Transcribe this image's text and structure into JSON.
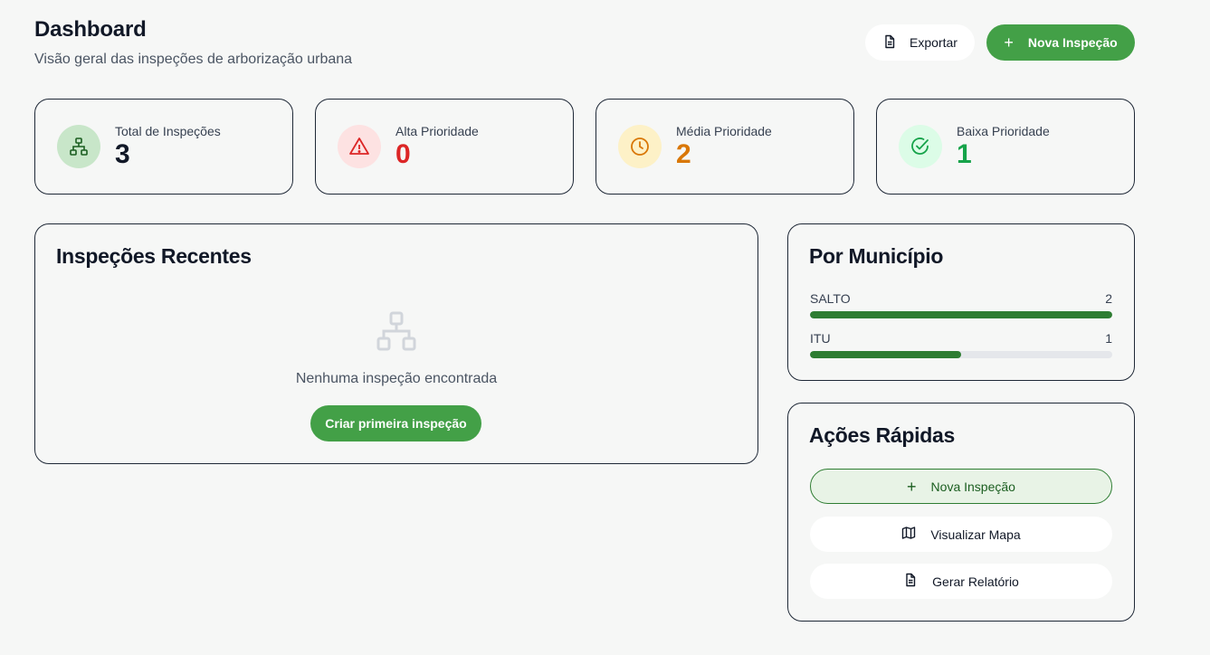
{
  "header": {
    "title": "Dashboard",
    "subtitle": "Visão geral das inspeções de arborização urbana",
    "export_label": "Exportar",
    "new_label": "Nova Inspeção"
  },
  "stats": [
    {
      "label": "Total de Inspeções",
      "value": "3",
      "color": "#111827",
      "bg": "#c8e6c9",
      "icon": "tree-structure-icon"
    },
    {
      "label": "Alta Prioridade",
      "value": "0",
      "color": "#dc2626",
      "bg": "#fde2e2",
      "icon": "alert-triangle-icon"
    },
    {
      "label": "Média Prioridade",
      "value": "2",
      "color": "#d97706",
      "bg": "#fdf1c7",
      "icon": "clock-icon"
    },
    {
      "label": "Baixa Prioridade",
      "value": "1",
      "color": "#16a34a",
      "bg": "#dcfce7",
      "icon": "check-circle-icon"
    }
  ],
  "recent": {
    "title": "Inspeções Recentes",
    "empty_text": "Nenhuma inspeção encontrada",
    "create_label": "Criar primeira inspeção"
  },
  "municipios": {
    "title": "Por Município",
    "items": [
      {
        "name": "SALTO",
        "count": "2",
        "fraction": 1.0
      },
      {
        "name": "ITU",
        "count": "1",
        "fraction": 0.5
      }
    ]
  },
  "quick_actions": {
    "title": "Ações Rápidas",
    "new_label": "Nova Inspeção",
    "map_label": "Visualizar Mapa",
    "report_label": "Gerar Relatório"
  },
  "colors": {
    "accent": "#43a047",
    "bar": "#2e7d32"
  }
}
